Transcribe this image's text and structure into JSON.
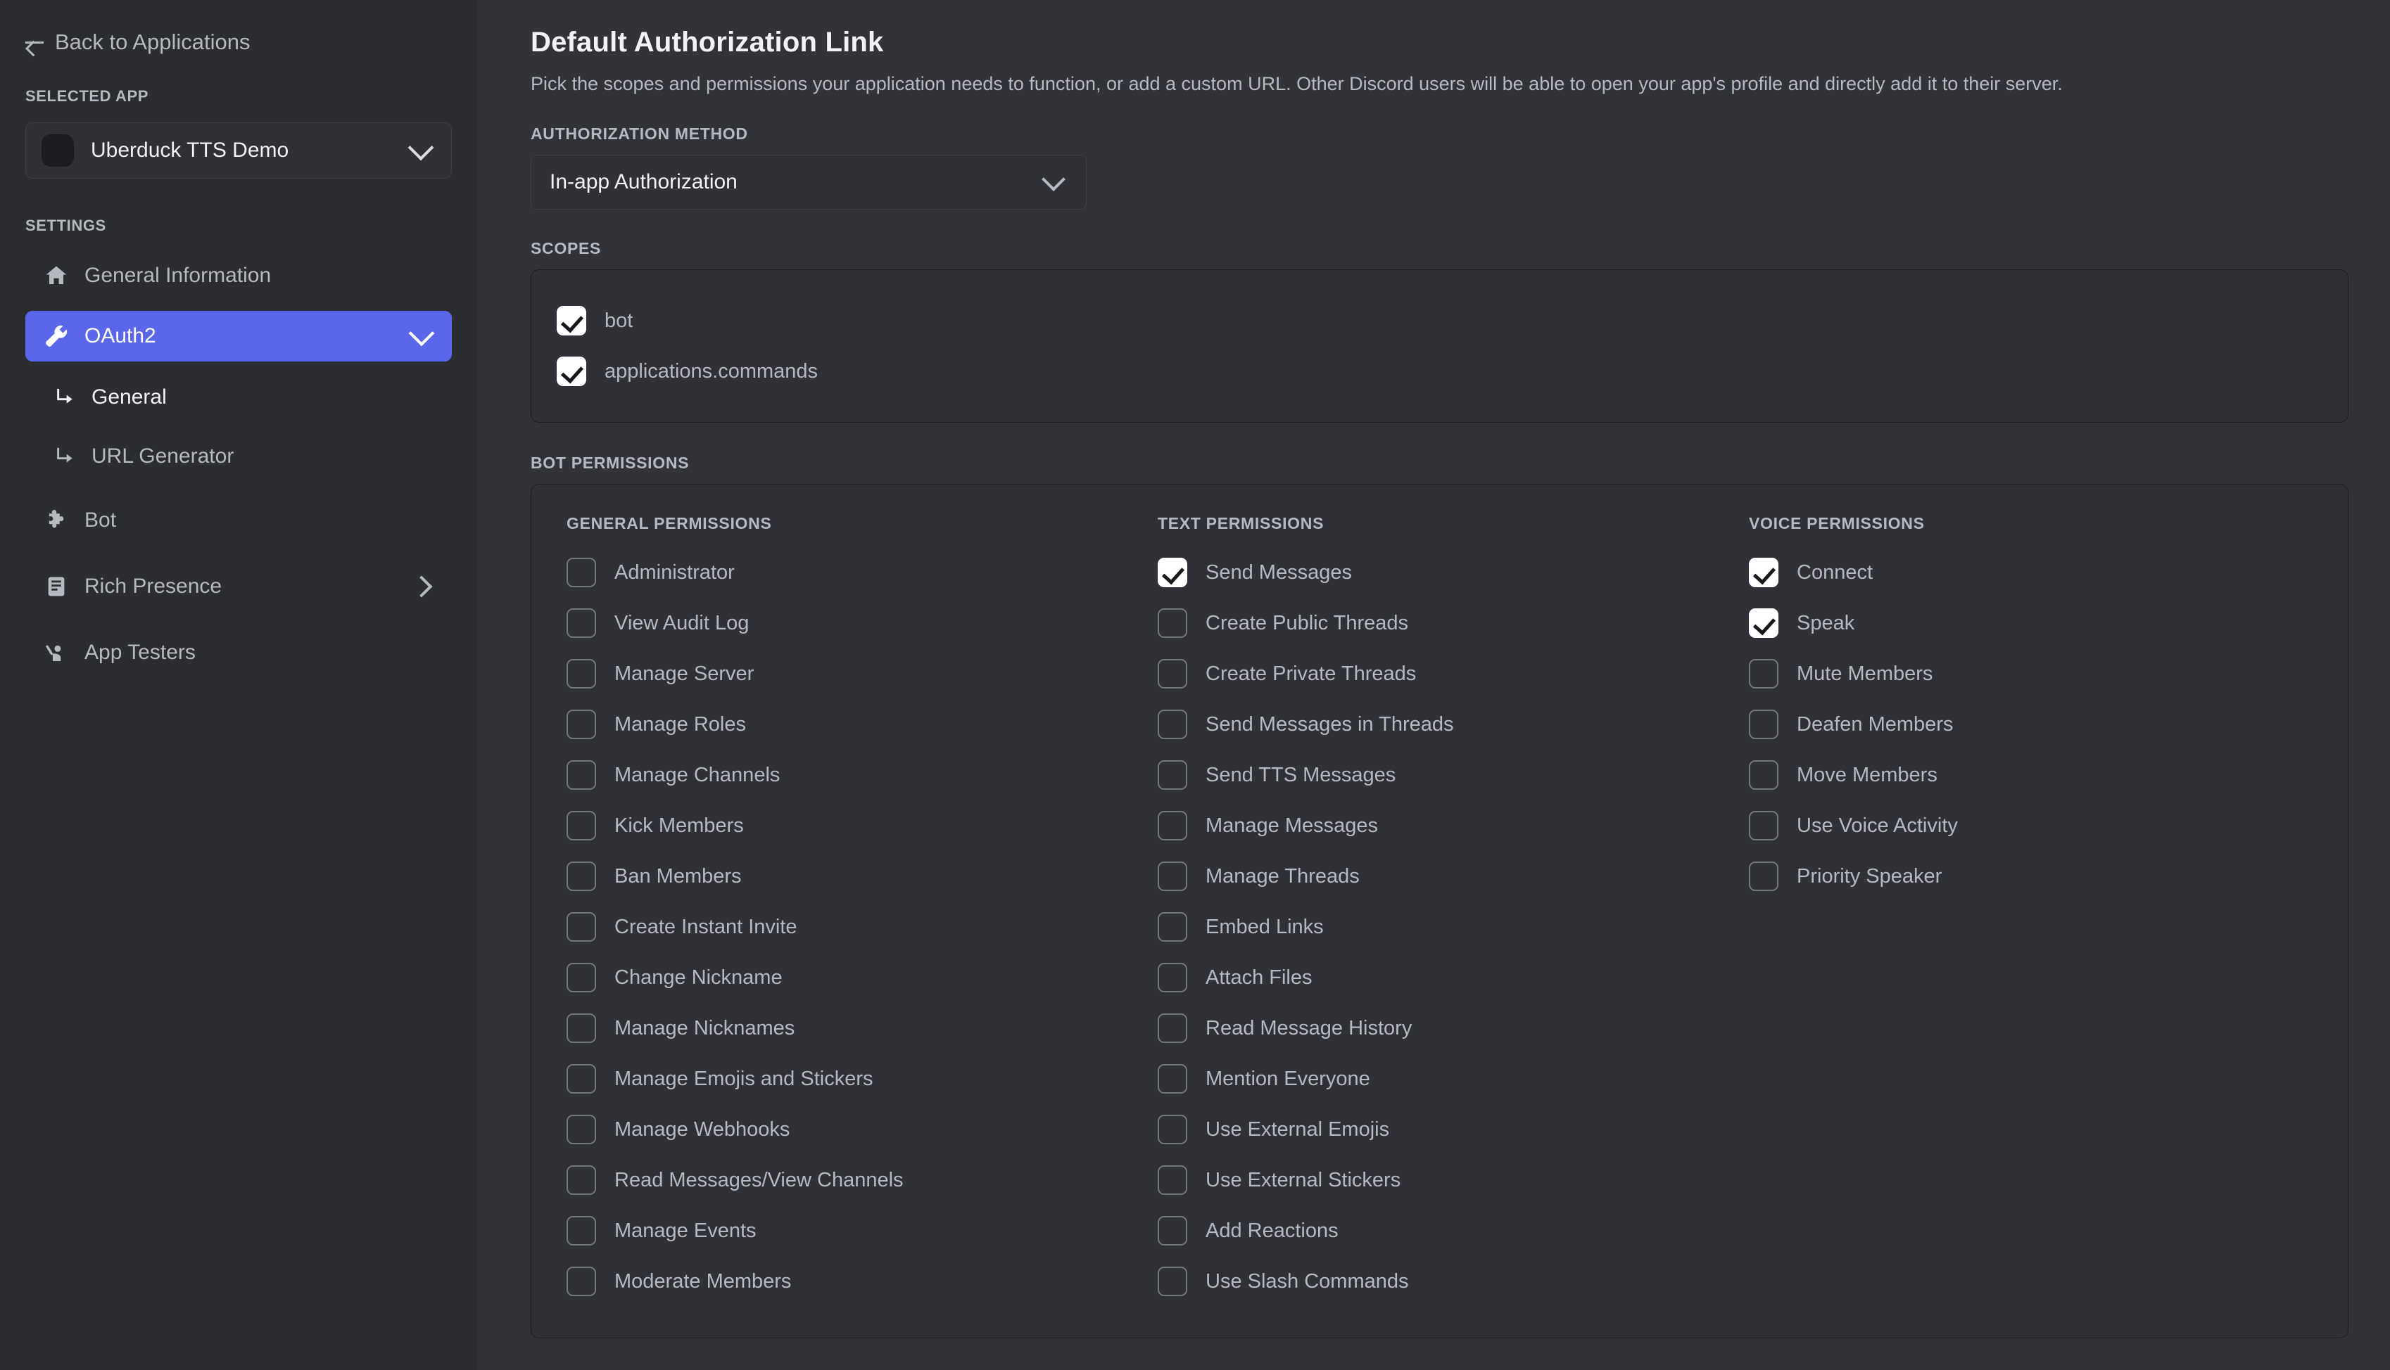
{
  "sidebar": {
    "back_label": "Back to Applications",
    "selected_app_heading": "SELECTED APP",
    "selected_app_name": "Uberduck TTS Demo",
    "settings_heading": "SETTINGS",
    "items": [
      {
        "label": "General Information",
        "icon": "home-icon"
      },
      {
        "label": "OAuth2",
        "icon": "wrench-icon"
      },
      {
        "label": "General",
        "icon": "arrow-branch-icon"
      },
      {
        "label": "URL Generator",
        "icon": "arrow-branch-icon"
      },
      {
        "label": "Bot",
        "icon": "puzzle-piece-icon"
      },
      {
        "label": "Rich Presence",
        "icon": "document-lines-icon"
      },
      {
        "label": "App Testers",
        "icon": "person-raising-hand-icon"
      }
    ]
  },
  "main": {
    "title": "Default Authorization Link",
    "description": "Pick the scopes and permissions your application needs to function, or add a custom URL. Other Discord users will be able to open your app's profile and directly add it to their server.",
    "auth_method_label": "AUTHORIZATION METHOD",
    "auth_method_value": "In-app Authorization",
    "scopes_label": "SCOPES",
    "scopes": [
      {
        "label": "bot",
        "checked": true
      },
      {
        "label": "applications.commands",
        "checked": true
      }
    ],
    "bot_permissions_label": "BOT PERMISSIONS",
    "permission_columns": [
      {
        "title": "GENERAL PERMISSIONS",
        "items": [
          {
            "label": "Administrator",
            "checked": false
          },
          {
            "label": "View Audit Log",
            "checked": false
          },
          {
            "label": "Manage Server",
            "checked": false
          },
          {
            "label": "Manage Roles",
            "checked": false
          },
          {
            "label": "Manage Channels",
            "checked": false
          },
          {
            "label": "Kick Members",
            "checked": false
          },
          {
            "label": "Ban Members",
            "checked": false
          },
          {
            "label": "Create Instant Invite",
            "checked": false
          },
          {
            "label": "Change Nickname",
            "checked": false
          },
          {
            "label": "Manage Nicknames",
            "checked": false
          },
          {
            "label": "Manage Emojis and Stickers",
            "checked": false
          },
          {
            "label": "Manage Webhooks",
            "checked": false
          },
          {
            "label": "Read Messages/View Channels",
            "checked": false
          },
          {
            "label": "Manage Events",
            "checked": false
          },
          {
            "label": "Moderate Members",
            "checked": false
          }
        ]
      },
      {
        "title": "TEXT PERMISSIONS",
        "items": [
          {
            "label": "Send Messages",
            "checked": true
          },
          {
            "label": "Create Public Threads",
            "checked": false
          },
          {
            "label": "Create Private Threads",
            "checked": false
          },
          {
            "label": "Send Messages in Threads",
            "checked": false
          },
          {
            "label": "Send TTS Messages",
            "checked": false
          },
          {
            "label": "Manage Messages",
            "checked": false
          },
          {
            "label": "Manage Threads",
            "checked": false
          },
          {
            "label": "Embed Links",
            "checked": false
          },
          {
            "label": "Attach Files",
            "checked": false
          },
          {
            "label": "Read Message History",
            "checked": false
          },
          {
            "label": "Mention Everyone",
            "checked": false
          },
          {
            "label": "Use External Emojis",
            "checked": false
          },
          {
            "label": "Use External Stickers",
            "checked": false
          },
          {
            "label": "Add Reactions",
            "checked": false
          },
          {
            "label": "Use Slash Commands",
            "checked": false
          }
        ]
      },
      {
        "title": "VOICE PERMISSIONS",
        "items": [
          {
            "label": "Connect",
            "checked": true
          },
          {
            "label": "Speak",
            "checked": true
          },
          {
            "label": "Mute Members",
            "checked": false
          },
          {
            "label": "Deafen Members",
            "checked": false
          },
          {
            "label": "Move Members",
            "checked": false
          },
          {
            "label": "Use Voice Activity",
            "checked": false
          },
          {
            "label": "Priority Speaker",
            "checked": false
          }
        ]
      }
    ]
  },
  "colors": {
    "accent": "#5b67ea",
    "sidebar_bg": "#2b2d31",
    "content_bg": "#313338",
    "panel_bg": "#2f3136",
    "text_primary": "#f2f3f5",
    "text_muted": "#b5bac1"
  }
}
